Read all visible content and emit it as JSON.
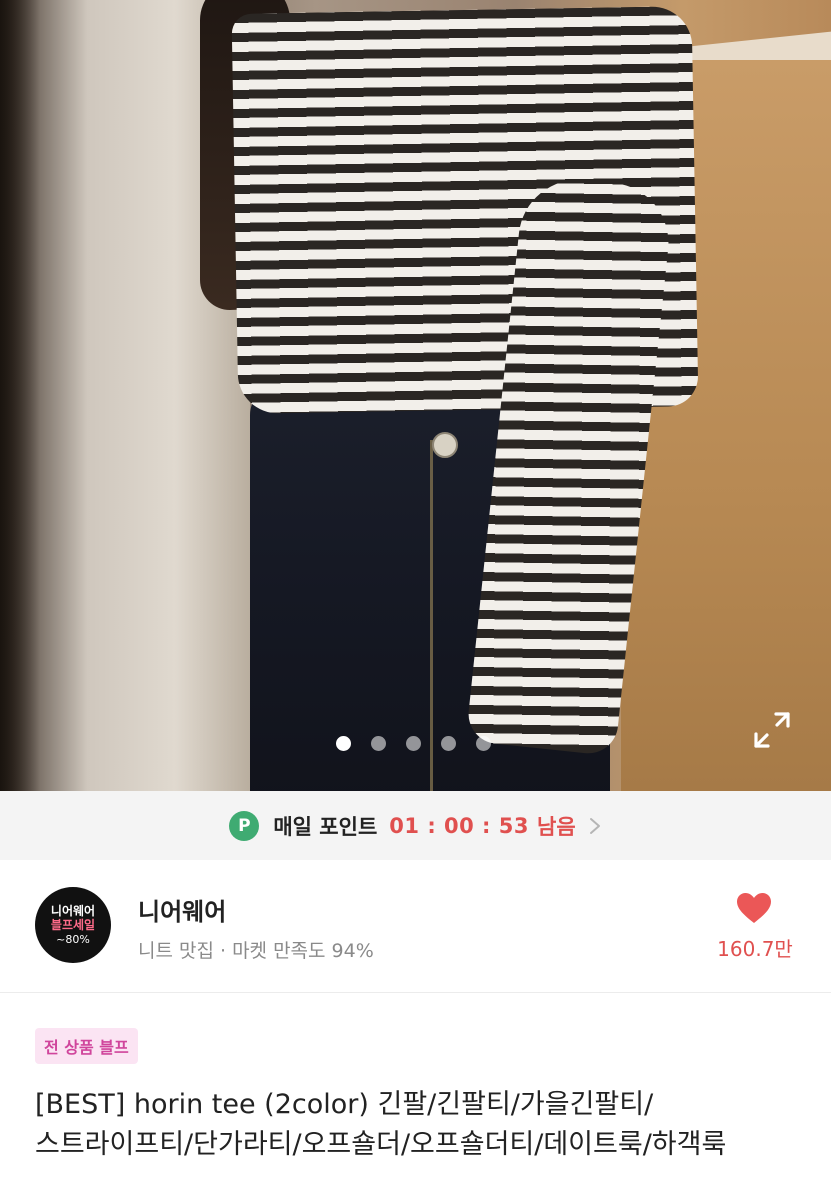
{
  "carousel": {
    "total_images": 5,
    "active_index": 0
  },
  "daily_points": {
    "badge": "P",
    "label": "매일 포인트",
    "timer": "01 : 00 : 53",
    "remaining": "남음"
  },
  "shop": {
    "logo_line1": "니어웨어",
    "logo_line2": "블프세일",
    "logo_line3": "~80%",
    "name": "니어웨어",
    "meta": "니트 맛집 · 마켓 만족도 94%",
    "like_count": "160.7만"
  },
  "product": {
    "tag": "전 상품 블프",
    "title": "[BEST] horin tee (2color) 긴팔/긴팔티/가을긴팔티/스트라이프티/단가라티/오프숄더/오프숄더티/데이트룩/하객룩"
  },
  "colors": {
    "accent_red": "#e0504f",
    "points_green": "#3fab72",
    "tag_pink": "#d0459c"
  },
  "icons": {
    "expand": "expand-icon",
    "chevron": "chevron-right-icon",
    "heart": "heart-icon"
  }
}
